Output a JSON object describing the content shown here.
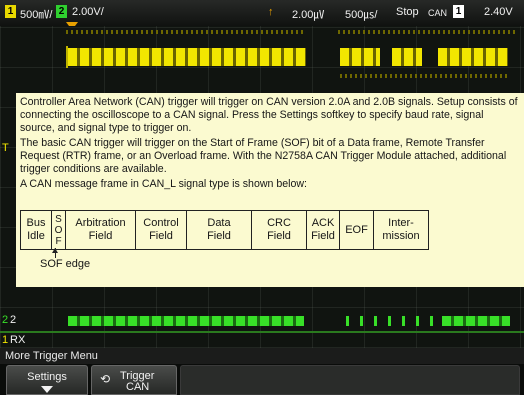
{
  "topbar": {
    "ch1_num": "1",
    "ch1_scale": "500㎷/",
    "ch2_num": "2",
    "ch2_scale": "2.00V/",
    "trigger_pos": "2.00㎶",
    "timebase": "500㎲/",
    "run_state": "Stop",
    "trigger_type": "CAN",
    "trigger_source_num": "1",
    "trigger_level": "2.40V"
  },
  "channels": {
    "ch1_marker": "T",
    "ch2_marker": "2",
    "rx_label": "RX",
    "rx_marker": "1"
  },
  "dialog": {
    "para1": "Controller Area Network (CAN) trigger will trigger on CAN version 2.0A and 2.0B signals. Setup consists of connecting the oscilloscope to a CAN signal. Press the Settings softkey to specify baud rate, signal source, and signal type to trigger on.",
    "para2": "The basic CAN trigger will trigger on the Start of Frame (SOF) bit of a Data frame, Remote Transfer Request (RTR) frame, or an Overload frame. With the N2758A CAN Trigger Module attached, additional trigger conditions are available.",
    "para3": "A CAN message frame in CAN_L signal type is shown below:",
    "frame_fields": [
      "Bus\nIdle",
      "S\nO\nF",
      "Arbitration\nField",
      "Control\nField",
      "Data\nField",
      "CRC\nField",
      "ACK\nField",
      "EOF",
      "Inter-\nmission"
    ],
    "sof_edge": "SOF edge"
  },
  "menu": {
    "title": "More Trigger Menu",
    "settings_label": "Settings",
    "trigger_label_1": "Trigger",
    "trigger_label_2": "CAN"
  },
  "colors": {
    "ch1": "#f2e600",
    "ch2": "#38e028",
    "dialog_bg": "#fbfad0"
  }
}
